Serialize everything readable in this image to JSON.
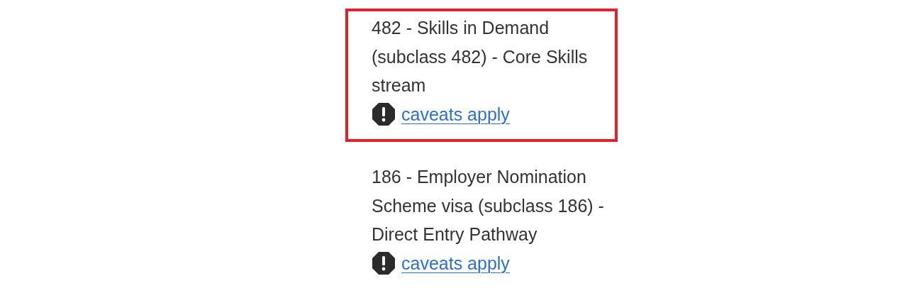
{
  "visas": [
    {
      "title": "482 - Skills in Demand (subclass 482) - Core Skills stream",
      "caveat_link": "caveats apply",
      "highlighted": true
    },
    {
      "title": "186 - Employer Nomination Scheme visa (subclass 186) - Direct Entry Pathway",
      "caveat_link": "caveats apply",
      "highlighted": false
    }
  ]
}
